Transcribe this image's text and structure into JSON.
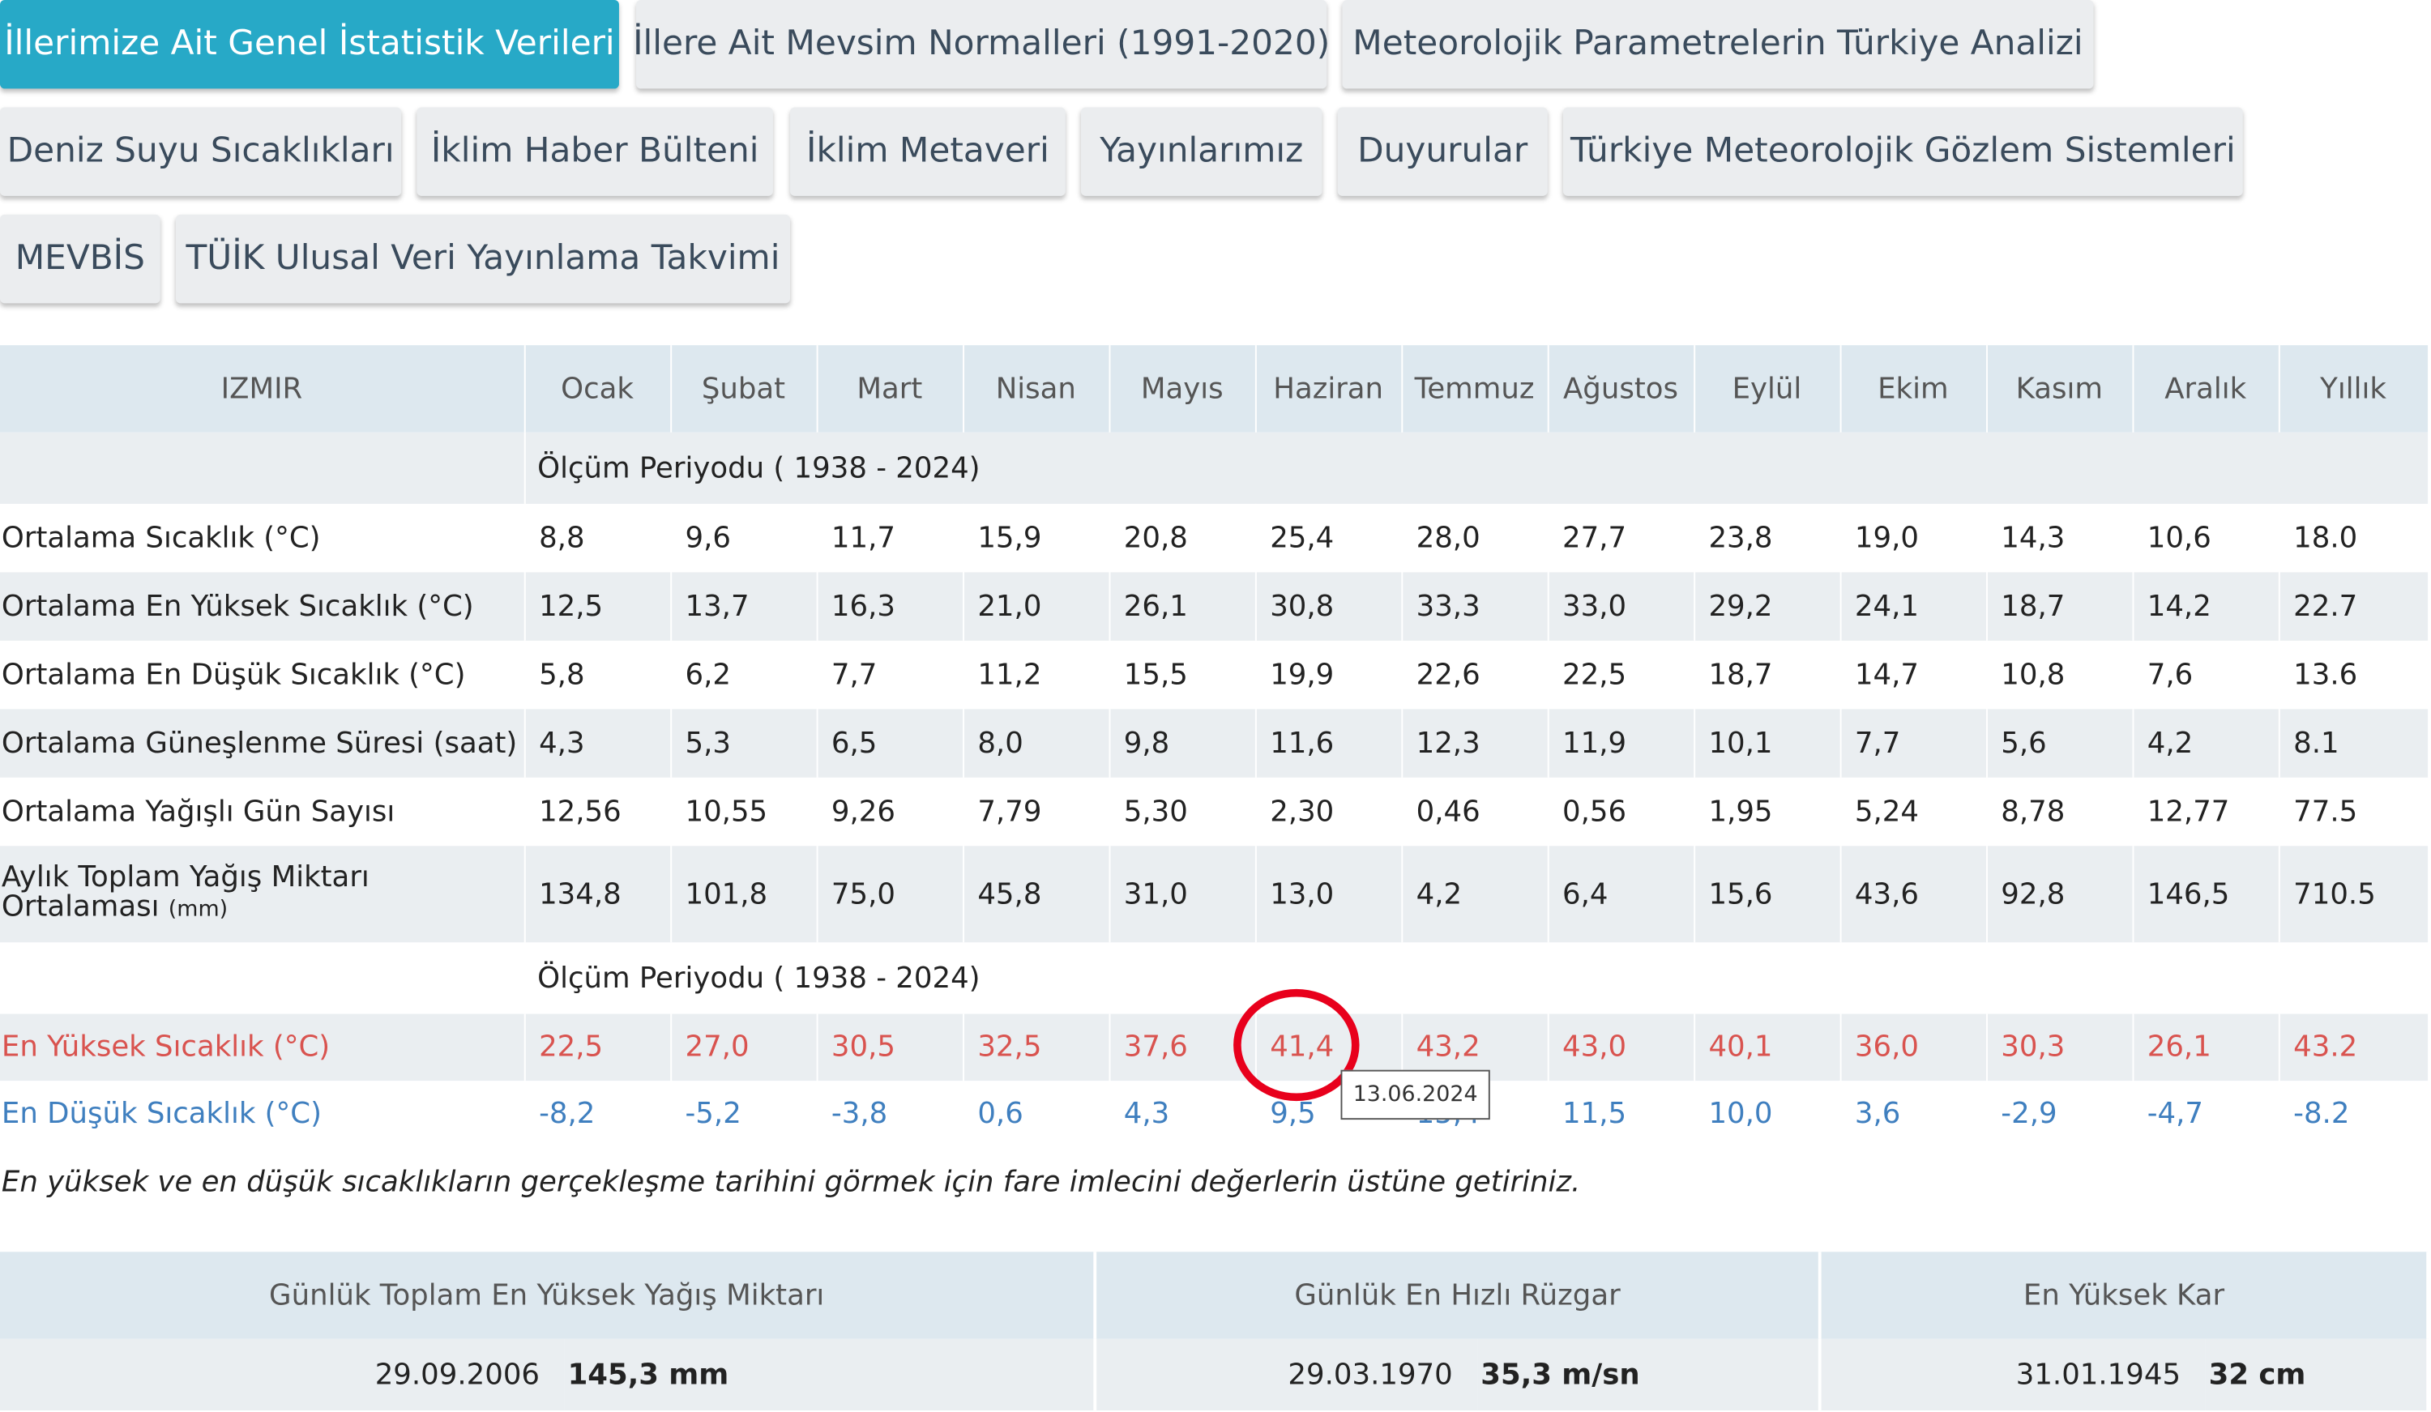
{
  "tabs": [
    {
      "label": "İllerimize Ait Genel İstatistik Verileri",
      "active": true
    },
    {
      "label": "İllere Ait Mevsim Normalleri (1991-2020)"
    },
    {
      "label": "Meteorolojik Parametrelerin Türkiye Analizi"
    },
    {
      "label": "Deniz Suyu Sıcaklıkları"
    },
    {
      "label": "İklim Haber Bülteni"
    },
    {
      "label": "İklim Metaveri"
    },
    {
      "label": "Yayınlarımız"
    },
    {
      "label": "Duyurular"
    },
    {
      "label": "Türkiye Meteorolojik Gözlem Sistemleri"
    },
    {
      "label": "MEVBİS"
    },
    {
      "label": "TÜİK Ulusal Veri Yayınlama Takvimi"
    }
  ],
  "stats_table": {
    "city": "IZMIR",
    "columns": [
      "Ocak",
      "Şubat",
      "Mart",
      "Nisan",
      "Mayıs",
      "Haziran",
      "Temmuz",
      "Ağustos",
      "Eylül",
      "Ekim",
      "Kasım",
      "Aralık",
      "Yıllık"
    ],
    "period1": "Ölçüm Periyodu ( 1938 - 2024)",
    "rows": [
      {
        "label": "Ortalama Sıcaklık (°C)",
        "values": [
          "8,8",
          "9,6",
          "11,7",
          "15,9",
          "20,8",
          "25,4",
          "28,0",
          "27,7",
          "23,8",
          "19,0",
          "14,3",
          "10,6",
          "18.0"
        ]
      },
      {
        "label": "Ortalama En Yüksek Sıcaklık (°C)",
        "values": [
          "12,5",
          "13,7",
          "16,3",
          "21,0",
          "26,1",
          "30,8",
          "33,3",
          "33,0",
          "29,2",
          "24,1",
          "18,7",
          "14,2",
          "22.7"
        ]
      },
      {
        "label": "Ortalama En Düşük Sıcaklık (°C)",
        "values": [
          "5,8",
          "6,2",
          "7,7",
          "11,2",
          "15,5",
          "19,9",
          "22,6",
          "22,5",
          "18,7",
          "14,7",
          "10,8",
          "7,6",
          "13.6"
        ]
      },
      {
        "label": "Ortalama Güneşlenme Süresi (saat)",
        "values": [
          "4,3",
          "5,3",
          "6,5",
          "8,0",
          "9,8",
          "11,6",
          "12,3",
          "11,9",
          "10,1",
          "7,7",
          "5,6",
          "4,2",
          "8.1"
        ]
      },
      {
        "label": "Ortalama Yağışlı Gün Sayısı",
        "values": [
          "12,56",
          "10,55",
          "9,26",
          "7,79",
          "5,30",
          "2,30",
          "0,46",
          "0,56",
          "1,95",
          "5,24",
          "8,78",
          "12,77",
          "77.5"
        ]
      },
      {
        "label_line1": "Aylık Toplam Yağış Miktarı",
        "label_line2": "Ortalaması",
        "unit": "(mm)",
        "values": [
          "134,8",
          "101,8",
          "75,0",
          "45,8",
          "31,0",
          "13,0",
          "4,2",
          "6,4",
          "15,6",
          "43,6",
          "92,8",
          "146,5",
          "710.5"
        ]
      }
    ],
    "period2": "Ölçüm Periyodu ( 1938 - 2024)",
    "extreme_high": {
      "label": "En Yüksek Sıcaklık (°C)",
      "values": [
        "22,5",
        "27,0",
        "30,5",
        "32,5",
        "37,6",
        "41,4",
        "43,2",
        "43,0",
        "40,1",
        "36,0",
        "30,3",
        "26,1",
        "43.2"
      ]
    },
    "extreme_low": {
      "label": "En Düşük Sıcaklık (°C)",
      "values": [
        "-8,2",
        "-5,2",
        "-3,8",
        "0,6",
        "4,3",
        "9,5",
        "15,4",
        "11,5",
        "10,0",
        "3,6",
        "-2,9",
        "-4,7",
        "-8.2"
      ]
    }
  },
  "note": "En yüksek ve en düşük sıcaklıkların gerçekleşme tarihini görmek için fare imlecini değerlerin üstüne getiriniz.",
  "tooltip": "13.06.2024",
  "colors": {
    "active_tab": "#27a9c7",
    "high": "#d9534f",
    "low": "#3f7fbf",
    "annotation": "#e8001c"
  },
  "records": [
    {
      "title": "Günlük Toplam En Yüksek Yağış Miktarı",
      "date": "29.09.2006",
      "value": "145,3 mm"
    },
    {
      "title": "Günlük En Hızlı Rüzgar",
      "date": "29.03.1970",
      "value": "35,3 m/sn"
    },
    {
      "title": "En Yüksek Kar",
      "date": "31.01.1945",
      "value": "32 cm"
    }
  ]
}
